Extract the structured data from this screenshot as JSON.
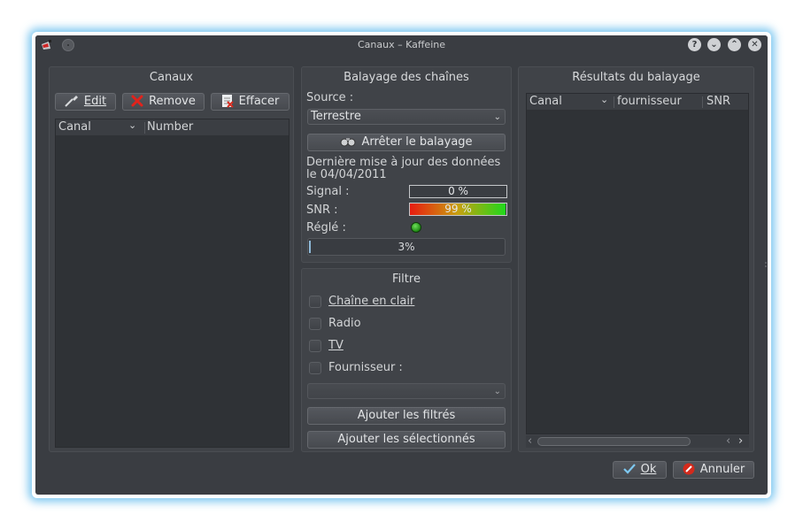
{
  "window": {
    "title": "Canaux – Kaffeine",
    "buttons": {
      "help": "?",
      "minimize": "⌄",
      "maximize": "⌃",
      "close": "✕"
    }
  },
  "channels": {
    "title": "Canaux",
    "edit_label": "Edit",
    "remove_label": "Remove",
    "clear_label": "Effacer",
    "columns": [
      "Canal",
      "Number"
    ]
  },
  "scan": {
    "title": "Balayage des chaînes",
    "source_label": "Source :",
    "source_value": "Terrestre",
    "stop_button": "Arrêter le balayage",
    "last_update": "Dernière mise à jour des données le 04/04/2011",
    "signal_label": "Signal :",
    "signal_value": "0 %",
    "signal_percent": 0,
    "snr_label": "SNR :",
    "snr_value": "99 %",
    "snr_percent": 99,
    "tuned_label": "Réglé :",
    "progress_text": "3%",
    "progress_percent": 3
  },
  "filter": {
    "title": "Filtre",
    "free_to_air": "Chaîne en clair",
    "radio": "Radio",
    "tv": "TV",
    "provider": "Fournisseur :",
    "provider_value": "",
    "add_filtered": "Ajouter les filtrés",
    "add_selected": "Ajouter les sélectionnés"
  },
  "results": {
    "title": "Résultats du balayage",
    "columns": [
      "Canal",
      "fournisseur",
      "SNR"
    ]
  },
  "footer": {
    "ok_label": "Ok",
    "cancel_label": "Annuler"
  },
  "colors": {
    "snr_start": "#e81c10",
    "snr_end": "#20d81c",
    "focus_glow": "#50b4eb",
    "window_bg": "#3a3d42"
  },
  "icons": [
    "app-icon",
    "window-menu-icon",
    "edit-icon",
    "remove-icon",
    "clear-icon",
    "binoculars-icon",
    "ok-check-icon",
    "cancel-icon"
  ]
}
